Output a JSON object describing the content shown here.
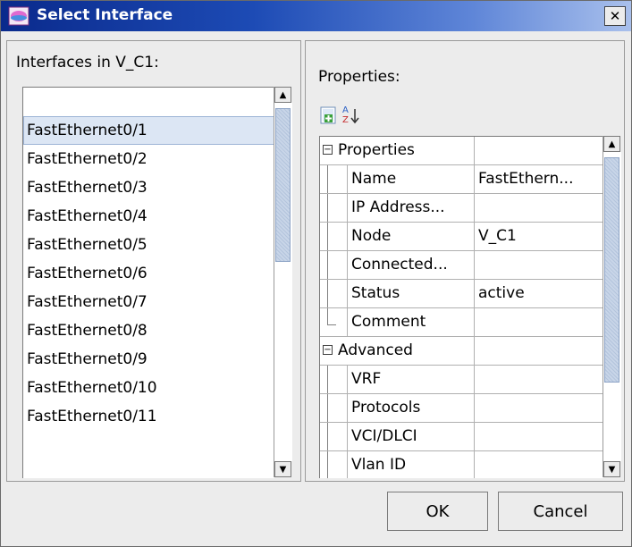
{
  "window": {
    "title": "Select Interface",
    "close_label": "✕"
  },
  "left": {
    "label": "Interfaces in V_C1:",
    "items": [
      "",
      "FastEthernet0/1",
      "FastEthernet0/2",
      "FastEthernet0/3",
      "FastEthernet0/4",
      "FastEthernet0/5",
      "FastEthernet0/6",
      "FastEthernet0/7",
      "FastEthernet0/8",
      "FastEthernet0/9",
      "FastEthernet0/10",
      "FastEthernet0/11"
    ],
    "selected_item": "FastEthernet0/1"
  },
  "right": {
    "label": "Properties:",
    "toolbar": {
      "categorized_icon": "categorized-view-icon",
      "sort_icon": "sort-alphabetical-icon",
      "sort_glyph_top": "A",
      "sort_glyph_bottom": "Z"
    },
    "categories": [
      {
        "name": "Properties",
        "collapse_glyph": "−",
        "rows": [
          {
            "name": "Name",
            "value": "FastEthern..."
          },
          {
            "name": "IP Address...",
            "value": ""
          },
          {
            "name": "Node",
            "value": "V_C1"
          },
          {
            "name": "Connected...",
            "value": ""
          },
          {
            "name": "Status",
            "value": "active"
          },
          {
            "name": "Comment",
            "value": ""
          }
        ]
      },
      {
        "name": "Advanced",
        "collapse_glyph": "−",
        "rows": [
          {
            "name": "VRF",
            "value": ""
          },
          {
            "name": "Protocols",
            "value": ""
          },
          {
            "name": "VCI/DLCI",
            "value": ""
          },
          {
            "name": "Vlan ID",
            "value": ""
          }
        ]
      }
    ]
  },
  "buttons": {
    "ok": "OK",
    "cancel": "Cancel"
  },
  "colors": {
    "title_gradient_start": "#0a2a8c",
    "title_gradient_end": "#a9c0ec",
    "selection": "#dce6f4",
    "dialog_bg": "#ececec"
  }
}
